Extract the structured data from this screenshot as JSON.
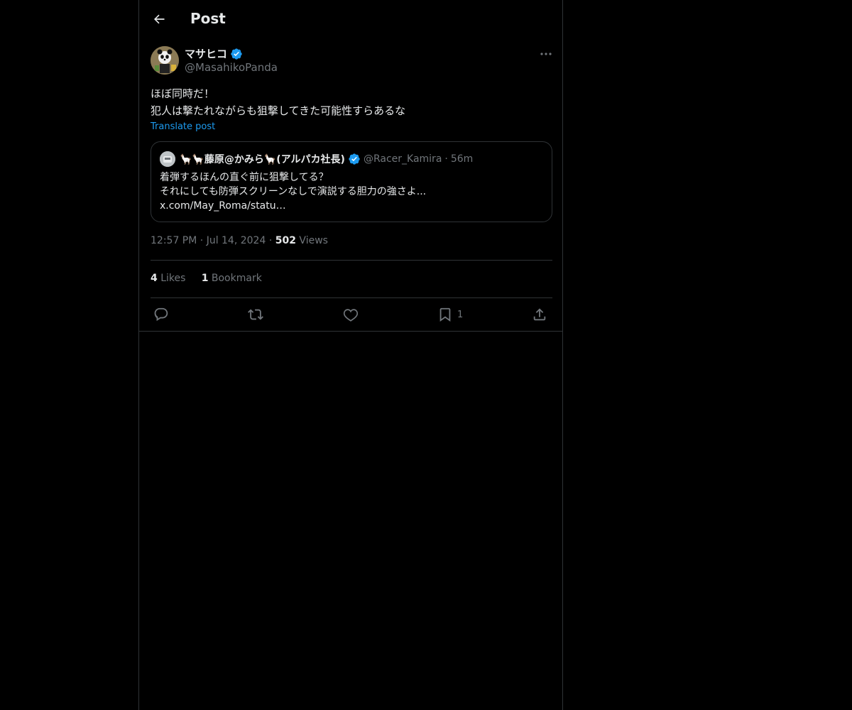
{
  "header": {
    "title": "Post"
  },
  "post": {
    "author": {
      "name": "マサヒコ",
      "handle": "@MasahikoPanda"
    },
    "text_line1": "ほぼ同時だ！",
    "text_line2": "犯人は撃たれながらも狙撃してきた可能性すらあるな",
    "translate_label": "Translate post",
    "quote": {
      "name": "🦙🦙藤原@かみら🦙(アルパカ社長)",
      "handle": "@Racer_Kamira",
      "separator": "·",
      "time": "56m",
      "line1": "着弾するほんの直ぐ前に狙撃してる？",
      "line2": "それにしても防弾スクリーンなしで演説する胆力の強さよ...",
      "line3": "x.com/May_Roma/statu…"
    },
    "meta": {
      "time": "12:57 PM",
      "sep1": "·",
      "date": "Jul 14, 2024",
      "sep2": "·",
      "views_count": "502",
      "views_label": "Views"
    },
    "stats": {
      "likes_count": "4",
      "likes_label": "Likes",
      "bookmarks_count": "1",
      "bookmarks_label": "Bookmark"
    },
    "actions": {
      "bookmark_count": "1"
    }
  },
  "colors": {
    "background": "#000000",
    "text": "#e7e9ea",
    "muted": "#71767b",
    "accent": "#1d9bf0",
    "border": "#2f3336"
  }
}
